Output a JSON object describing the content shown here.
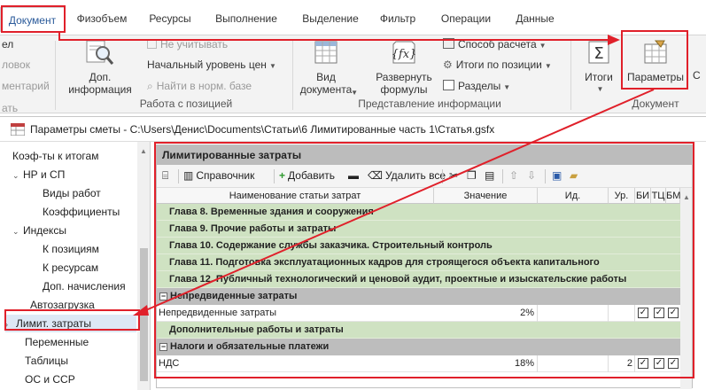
{
  "ribbon_tabs": [
    "Документ",
    "Физобъем",
    "Ресурсы",
    "Выполнение",
    "Выделение",
    "Фильтр",
    "Операции",
    "Данные"
  ],
  "ribbon": {
    "left_cut": [
      "ел",
      "ловок",
      "ментарий",
      "ать"
    ],
    "dop_info": "Доп.\nинформация",
    "ne_uchityvat": "Не учитывать",
    "nachalny_uroven": "Начальный уровень цен",
    "nayti_v_norm": "Найти в норм. базе",
    "group_pos": "Работа с позицией",
    "vid_dokumenta": "Вид\nдокумента",
    "razvernut": "Развернуть\nформулы",
    "sposob": "Способ расчета",
    "itogi_pos": "Итоги по позиции",
    "razdely": "Разделы",
    "group_view": "Представление информации",
    "itogi": "Итоги",
    "parametry": "Параметры",
    "group_doc": "Документ",
    "extra": "С"
  },
  "dialog": {
    "title": "Параметры сметы - C:\\Users\\Денис\\Documents\\Статьи\\6 Лимитированные часть 1\\Статья.gsfx"
  },
  "tree": [
    "Коэф-ты к итогам",
    "НР и СП",
    "Виды работ",
    "Коэффициенты",
    "Индексы",
    "К позициям",
    "К ресурсам",
    "Доп. начисления",
    "Автозагрузка",
    "Лимит. затраты",
    "Переменные",
    "Таблицы",
    "ОС и ССР"
  ],
  "panel": {
    "title": "Лимитированные затраты",
    "toolbar": {
      "spravochnik": "Справочник",
      "dobavit": "Добавить",
      "udalit": "Удалить все"
    },
    "headers": [
      "Наименование статьи затрат",
      "Значение",
      "Ид.",
      "Ур.",
      "БИ",
      "ТЦ",
      "БМ"
    ],
    "rows": [
      {
        "type": "chapter",
        "name": "Глава 8. Временные здания и сооружения"
      },
      {
        "type": "chapter",
        "name": "Глава 9. Прочие работы и затраты"
      },
      {
        "type": "chapter",
        "name": "Глава 10. Содержание службы заказчика. Строительный контроль"
      },
      {
        "type": "chapter",
        "name": "Глава 11. Подготовка эксплуатационных кадров для строящегося объекта капитального"
      },
      {
        "type": "chapter",
        "name": "Глава 12. Публичный технологический и ценовой аудит, проектные и изыскательские работы"
      },
      {
        "type": "group",
        "name": "Непредвиденные затраты"
      },
      {
        "type": "data",
        "name": "Непредвиденные затраты",
        "value": "2%",
        "level": ""
      },
      {
        "type": "chapter",
        "name": "Дополнительные работы и затраты"
      },
      {
        "type": "group",
        "name": "Налоги и обязательные платежи"
      },
      {
        "type": "data",
        "name": "НДС",
        "value": "18%",
        "level": "2"
      }
    ]
  }
}
